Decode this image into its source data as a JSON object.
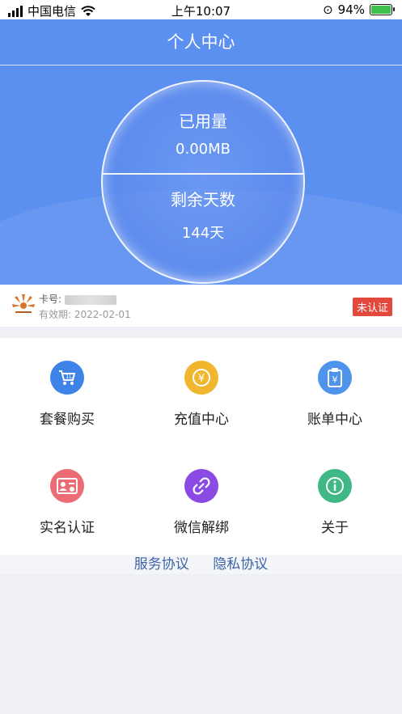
{
  "status_bar": {
    "carrier": "中国电信",
    "time": "上午10:07",
    "battery": "94%",
    "battery_level": 0.94
  },
  "header": {
    "title": "个人中心"
  },
  "usage": {
    "used_label": "已用量",
    "used_value": "0.00MB",
    "days_label": "剩余天数",
    "days_value": "144天"
  },
  "card": {
    "number_label": "卡号:",
    "expiry_label": "有效期:",
    "expiry_value": "2022-02-01",
    "auth_badge": "未认证"
  },
  "menu": [
    {
      "label": "套餐购买",
      "icon": "cart-icon",
      "color": "#3f82e8"
    },
    {
      "label": "充值中心",
      "icon": "yen-coin-icon",
      "color": "#f0b62e"
    },
    {
      "label": "账单中心",
      "icon": "bill-clipboard-icon",
      "color": "#4e93ec"
    },
    {
      "label": "实名认证",
      "icon": "id-card-icon",
      "color": "#ec6c75"
    },
    {
      "label": "微信解绑",
      "icon": "unlink-icon",
      "color": "#8a4ae3"
    },
    {
      "label": "关于",
      "icon": "info-icon",
      "color": "#3fb886"
    }
  ],
  "footer_links": {
    "service": "服务协议",
    "privacy": "隐私协议"
  }
}
